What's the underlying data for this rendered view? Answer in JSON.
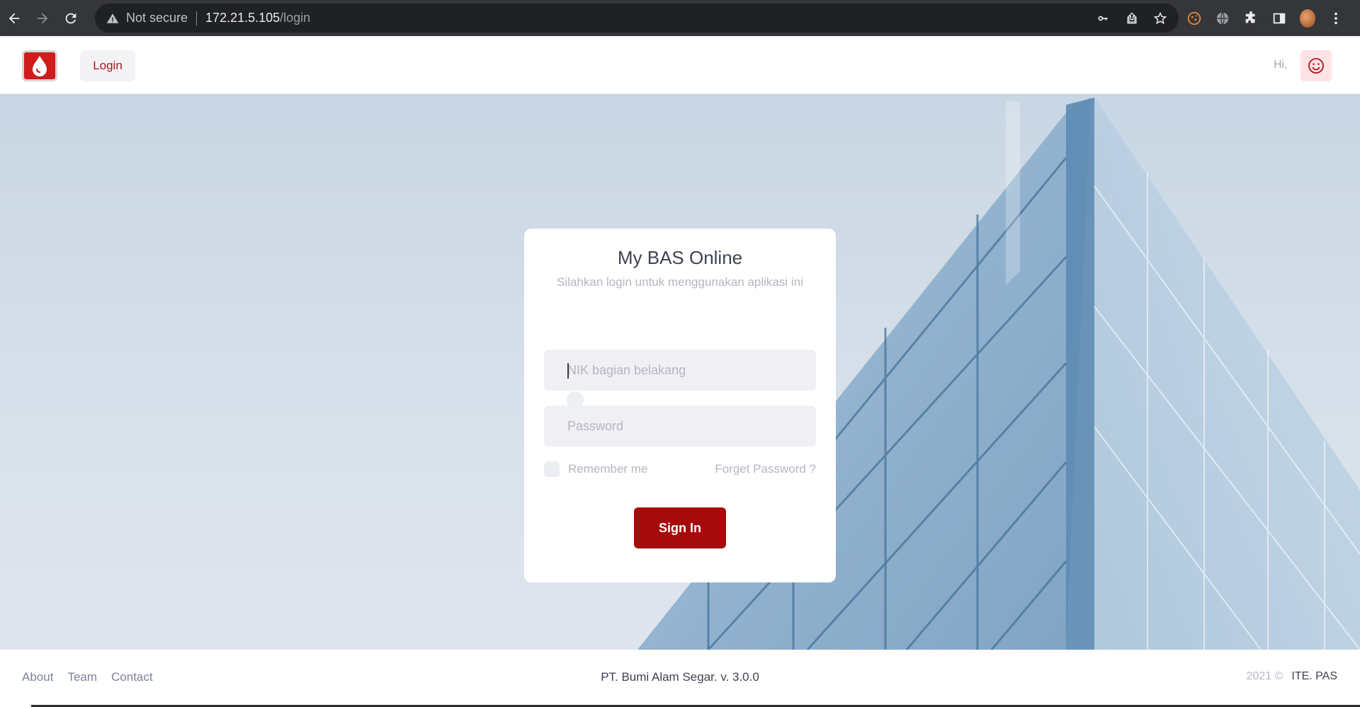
{
  "browser": {
    "security_label": "Not secure",
    "url_host": "172.21.5.105",
    "url_path": "/login"
  },
  "header": {
    "nav_login": "Login",
    "greeting": "Hi,"
  },
  "login_card": {
    "title": "My BAS Online",
    "subtitle": "Silahkan login untuk menggunakan aplikasi ini",
    "nik_placeholder": "NIK bagian belakang",
    "password_placeholder": "Password",
    "remember_label": "Remember me",
    "forget_link": "Forget Password ?",
    "signin_label": "Sign In"
  },
  "footer": {
    "links": [
      "About",
      "Team",
      "Contact"
    ],
    "company": "PT. Bumi Alam Segar. v. 3.0.0",
    "year": "2021 ©",
    "org": "ITE. PAS"
  },
  "colors": {
    "brand_red": "#a70a0a",
    "logo_red": "#cf1c1c",
    "muted_text": "#b5b5c3"
  }
}
